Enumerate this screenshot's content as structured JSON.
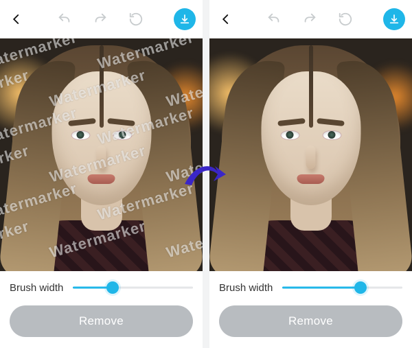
{
  "watermark_text": "Watermarker",
  "panels": {
    "left": {
      "slider_label": "Brush width",
      "slider_value_pct": 33,
      "remove_label": "Remove",
      "has_watermark": true
    },
    "right": {
      "slider_label": "Brush width",
      "slider_value_pct": 65,
      "remove_label": "Remove",
      "has_watermark": false
    }
  },
  "icons": {
    "back": "chevron-left",
    "undo": "undo",
    "redo": "redo",
    "revert": "revert-circle",
    "download": "download"
  },
  "accent": "#1fb6e8",
  "arrow_color": "#3a26c7"
}
